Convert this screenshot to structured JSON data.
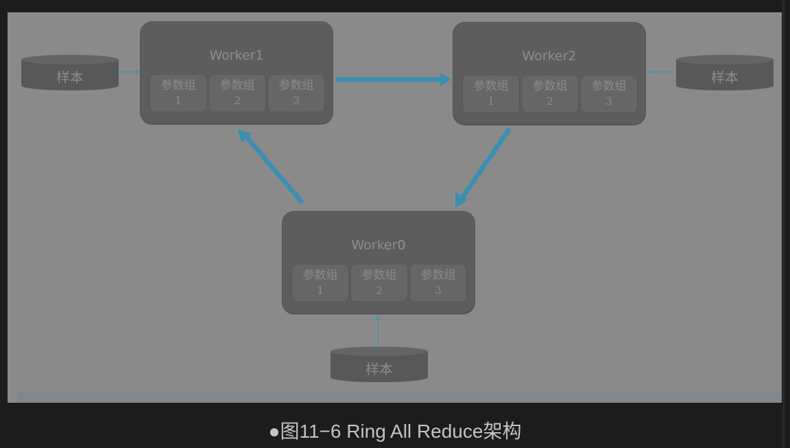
{
  "diagram": {
    "workers": [
      {
        "title": "Worker1",
        "groups": [
          {
            "label": "参数组",
            "num": "1"
          },
          {
            "label": "参数组",
            "num": "2"
          },
          {
            "label": "参数组",
            "num": "3"
          }
        ]
      },
      {
        "title": "Worker2",
        "groups": [
          {
            "label": "参数组",
            "num": "1"
          },
          {
            "label": "参数组",
            "num": "2"
          },
          {
            "label": "参数组",
            "num": "3"
          }
        ]
      },
      {
        "title": "Worker0",
        "groups": [
          {
            "label": "参数组",
            "num": "1"
          },
          {
            "label": "参数组",
            "num": "2"
          },
          {
            "label": "参数组",
            "num": "3"
          }
        ]
      }
    ],
    "samples": [
      "样本",
      "样本",
      "样本"
    ],
    "colors": {
      "ring_arrow": "#3d8fb0",
      "feed_arrow": "#4a8fb0",
      "worker_fill": "#5d5d5d",
      "panel_fill": "#8a8a8a"
    }
  },
  "caption": "●图11−6 Ring All Reduce架构"
}
